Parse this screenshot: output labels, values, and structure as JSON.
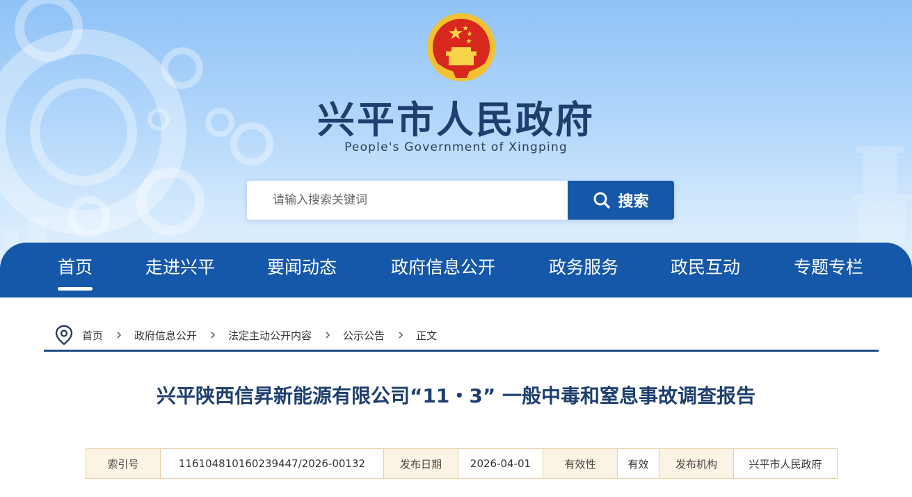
{
  "header": {
    "emblem_icon": "national-emblem-icon",
    "site_title": "兴平市人民政府",
    "site_subtitle": "People's Government of Xingping",
    "search": {
      "placeholder": "请输入搜索关键词",
      "value": "",
      "button_label": "搜索",
      "button_icon": "search-icon"
    }
  },
  "nav": {
    "items": [
      {
        "label": "首页",
        "active": true
      },
      {
        "label": "走进兴平",
        "active": false
      },
      {
        "label": "要闻动态",
        "active": false
      },
      {
        "label": "政府信息公开",
        "active": false
      },
      {
        "label": "政务服务",
        "active": false
      },
      {
        "label": "政民互动",
        "active": false
      },
      {
        "label": "专题专栏",
        "active": false
      }
    ]
  },
  "breadcrumb": {
    "icon": "location-pin-icon",
    "items": [
      "首页",
      "政府信息公开",
      "法定主动公开内容",
      "公示公告",
      "正文"
    ]
  },
  "article": {
    "title": "兴平陕西信昇新能源有限公司“11・3” 一般中毒和窒息事故调查报告"
  },
  "meta": {
    "index_label": "索引号",
    "index_value": "11610481016023944​7/2026-00132",
    "date_label": "发布日期",
    "date_value": "2026-04-01",
    "validity_label": "有效性",
    "validity_value": "有效",
    "agency_label": "发布机构",
    "agency_value": "兴平市人民政府"
  },
  "colors": {
    "nav_blue": "#1557a8",
    "title_navy": "#1e3f6e",
    "divider_navy": "#1e4b86",
    "meta_border": "#e6cfa4",
    "meta_label_bg": "#fbf3e3"
  }
}
